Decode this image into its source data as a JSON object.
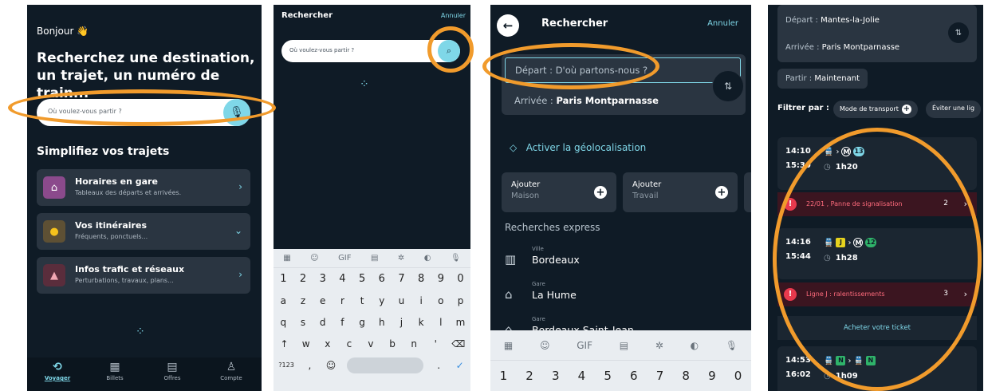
{
  "screen1": {
    "greeting": "Bonjour",
    "greeting_emoji": "👋",
    "headline": "Recherchez une destination, un trajet, un numéro de train...",
    "search_placeholder": "Où voulez-vous partir ?",
    "section_title": "Simplifiez vos trajets",
    "cards": [
      {
        "title": "Horaires en gare",
        "subtitle": "Tableaux des départs et arrivées.",
        "icon": "station-icon",
        "icon_bg": "#8b4a8c",
        "chevron": "›"
      },
      {
        "title": "Vos itinéraires",
        "subtitle": "Fréquents, ponctuels...",
        "icon": "pin-icon",
        "icon_bg": "#5e5034",
        "chevron": "⌄"
      },
      {
        "title": "Infos trafic et réseaux",
        "subtitle": "Perturbations, travaux, plans...",
        "icon": "cone-icon",
        "icon_bg": "#5a2d3c",
        "chevron": "›"
      }
    ],
    "tabs": [
      {
        "label": "Voyager",
        "icon": "journey-icon",
        "active": true
      },
      {
        "label": "Billets",
        "icon": "qr-icon",
        "active": false
      },
      {
        "label": "Offres",
        "icon": "book-icon",
        "active": false
      },
      {
        "label": "Compte",
        "icon": "person-icon",
        "active": false
      }
    ]
  },
  "screen2": {
    "title": "Rechercher",
    "cancel": "Annuler",
    "search_placeholder": "Où voulez-vous partir ?",
    "keyboard": {
      "tool_gif": "GIF",
      "numbers": [
        "1",
        "2",
        "3",
        "4",
        "5",
        "6",
        "7",
        "8",
        "9",
        "0"
      ],
      "row1": [
        "a",
        "z",
        "e",
        "r",
        "t",
        "y",
        "u",
        "i",
        "o",
        "p"
      ],
      "row2": [
        "q",
        "s",
        "d",
        "f",
        "g",
        "h",
        "j",
        "k",
        "l",
        "m"
      ],
      "row3": [
        "w",
        "x",
        "c",
        "v",
        "b",
        "n",
        "'"
      ],
      "mode": "?123"
    }
  },
  "screen3": {
    "title": "Rechercher",
    "cancel": "Annuler",
    "departure_label": "Départ : D'où partons-nous ?",
    "arrival_label": "Arrivée : ",
    "arrival_value": "Paris Montparnasse",
    "geolocation": "Activer la géolocalisation",
    "quick_add": [
      {
        "label": "Ajouter",
        "sub": "Maison"
      },
      {
        "label": "Ajouter",
        "sub": "Travail"
      }
    ],
    "express_title": "Recherches express",
    "express": [
      {
        "type": "Ville",
        "name": "Bordeaux",
        "icon": "city-icon"
      },
      {
        "type": "Gare",
        "name": "La Hume",
        "icon": "station-icon"
      },
      {
        "type": "Gare",
        "name": "Bordeaux Saint-Jean",
        "icon": "station-icon"
      }
    ],
    "keyboard": {
      "tool_gif": "GIF",
      "numbers": [
        "1",
        "2",
        "3",
        "4",
        "5",
        "6",
        "7",
        "8",
        "9",
        "0"
      ]
    }
  },
  "screen4": {
    "departure_label": "Départ : ",
    "departure_value": "Mantes-la-Jolie",
    "arrival_label": "Arrivée : ",
    "arrival_value": "Paris Montparnasse",
    "leave_label": "Partir : ",
    "leave_value": "Maintenant",
    "filter_label": "Filtrer par :",
    "filter_chips": [
      "Mode de transport",
      "Éviter une lig"
    ],
    "trips": [
      {
        "depart": "14:10",
        "arrive": "15:30",
        "duration": "1h20"
      },
      {
        "depart": "14:16",
        "arrive": "15:44",
        "duration": "1h28"
      },
      {
        "depart": "14:53",
        "arrive": "16:02",
        "duration": "1h09"
      }
    ],
    "alerts": [
      {
        "text": "22/01 , Panne de signalisation",
        "count": "2"
      },
      {
        "text": "Ligne J : ralentissements",
        "count": "3"
      }
    ],
    "line_badges": {
      "metro13": "13",
      "lineJ": "J",
      "metro12": "12",
      "lineN": "N",
      "metro": "M"
    },
    "buy_ticket": "Acheter votre ticket"
  },
  "colors": {
    "background": "#0f1b26",
    "accent": "#7fd7e8",
    "annotation": "#f19b2c",
    "alert": "#e8394d"
  }
}
